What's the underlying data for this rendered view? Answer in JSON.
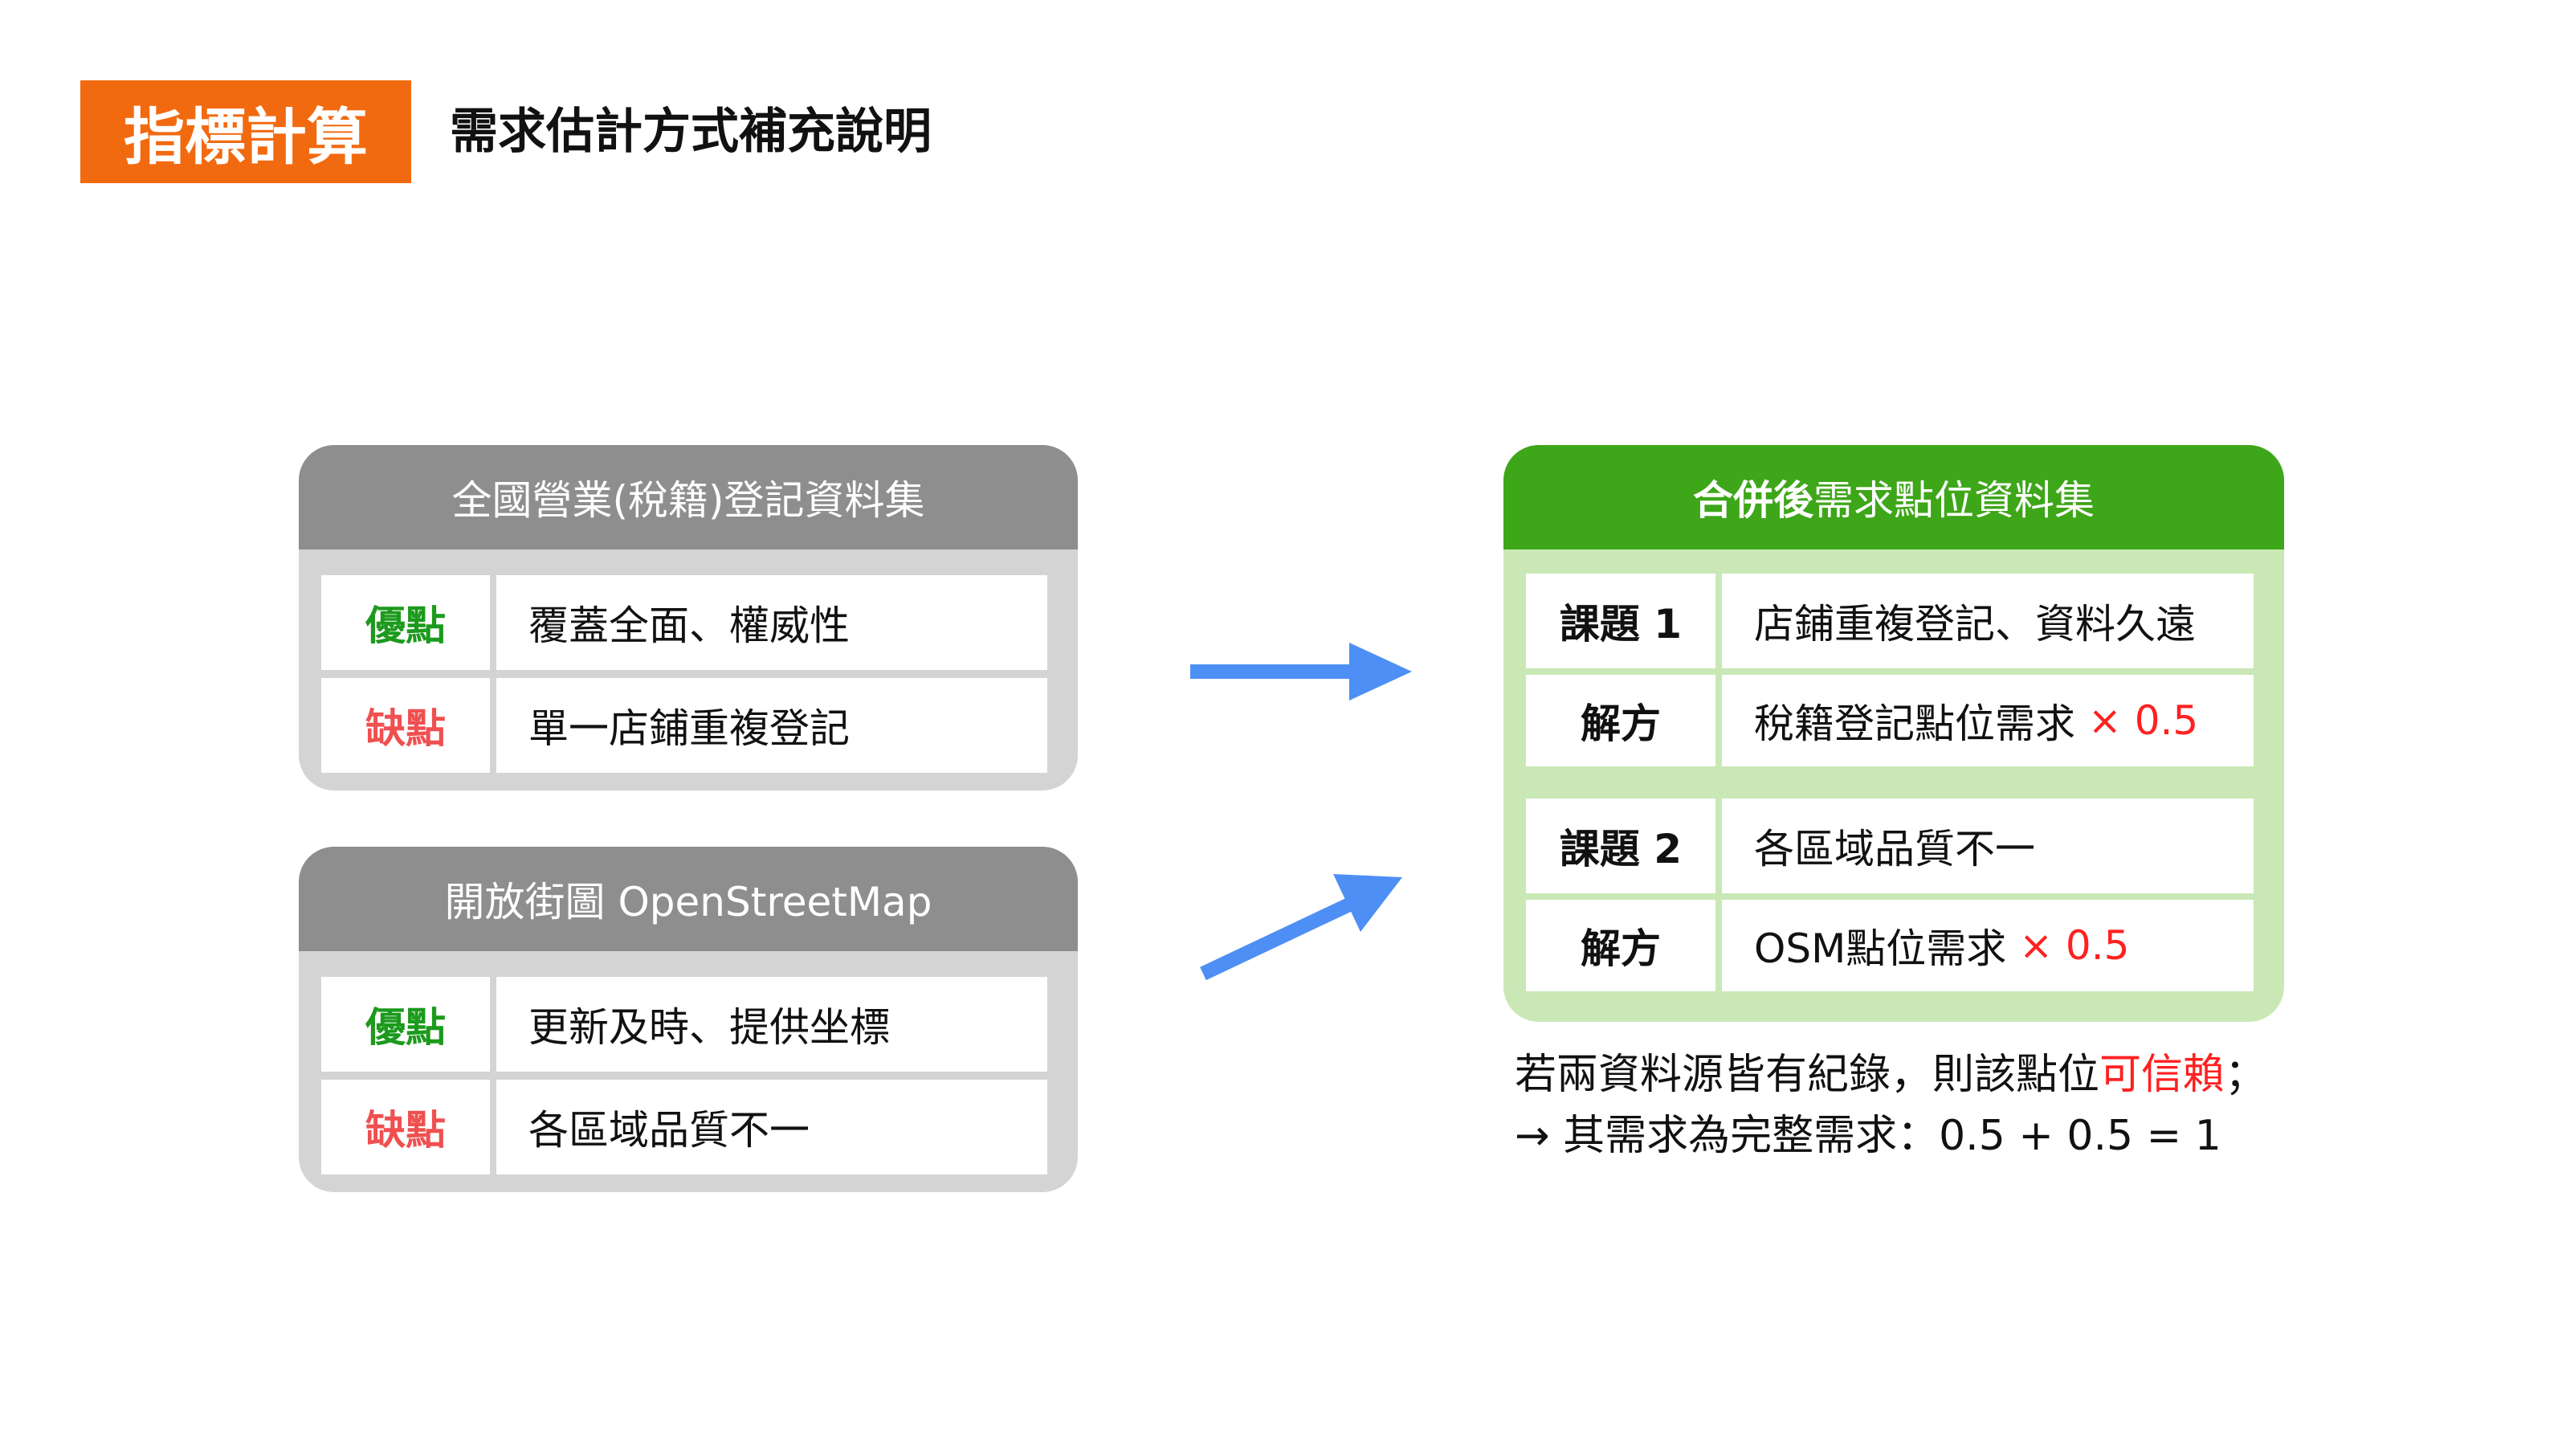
{
  "header": {
    "tag": "指標計算",
    "subtitle": "需求估計方式補充說明"
  },
  "tax_card": {
    "title": "全國營業(稅籍)登記資料集",
    "rows": [
      {
        "label": "優點",
        "text": "覆蓋全面、權威性"
      },
      {
        "label": "缺點",
        "text": "單一店鋪重複登記"
      }
    ]
  },
  "osm_card": {
    "title": "開放街圖 OpenStreetMap",
    "rows": [
      {
        "label": "優點",
        "text": "更新及時、提供坐標"
      },
      {
        "label": "缺點",
        "text": "各區域品質不一"
      }
    ]
  },
  "merged_card": {
    "title_bold": "合併後",
    "title_rest": "需求點位資料集",
    "groups": [
      {
        "issue_label": "課題 1",
        "issue_text": "店鋪重複登記、資料久遠",
        "solution_label": "解方",
        "solution_text": "稅籍登記點位需求",
        "solution_factor": "× 0.5"
      },
      {
        "issue_label": "課題 2",
        "issue_text": "各區域品質不一",
        "solution_label": "解方",
        "solution_text": "OSM點位需求",
        "solution_factor": "× 0.5"
      }
    ]
  },
  "note": {
    "line1_pre": "若兩資料源皆有紀錄，則該點位",
    "line1_highlight": "可信賴",
    "line1_post": "；",
    "line2": "→ 其需求為完整需求：0.5 + 0.5 = 1"
  },
  "colors": {
    "accent_orange": "#f26a10",
    "gray_header": "#8e8e8e",
    "green_header": "#3ea619",
    "green_body": "#c9e8b5",
    "arrow_blue": "#4e8ff5",
    "pro_green": "#1c9a1c",
    "con_red": "#f05050",
    "highlight_red": "#ff2020"
  }
}
